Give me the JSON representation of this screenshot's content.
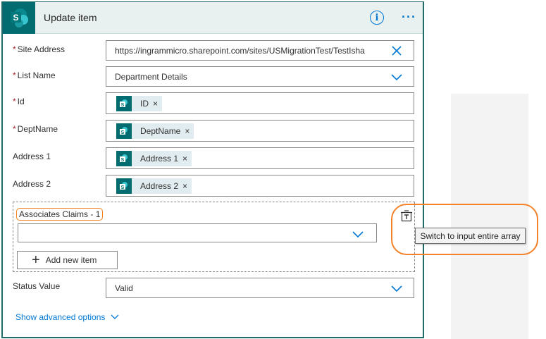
{
  "header": {
    "title": "Update item",
    "logo_letter": "S",
    "info_icon": "info-icon",
    "more_icon": "more-icon"
  },
  "fields": {
    "site_address": {
      "label": "Site Address",
      "required": "*",
      "value": "https://ingrammicro.sharepoint.com/sites/USMigrationTest/TestIsha"
    },
    "list_name": {
      "label": "List Name",
      "required": "*",
      "value": "Department Details"
    },
    "id": {
      "label": "Id",
      "required": "*",
      "token": "ID"
    },
    "dept_name": {
      "label": "DeptName",
      "required": "*",
      "token": "DeptName"
    },
    "address1": {
      "label": "Address 1",
      "token": "Address 1"
    },
    "address2": {
      "label": "Address 2",
      "token": "Address 2"
    },
    "status_value": {
      "label": "Status Value",
      "value": "Valid"
    }
  },
  "token_remove": "×",
  "array": {
    "label": "Associates Claims - 1",
    "add_label": "Add new item",
    "tooltip": "Switch to input entire array"
  },
  "advanced_label": "Show advanced options",
  "colors": {
    "brand": "#036c70",
    "accent": "#0078d4",
    "highlight": "#f58220",
    "required": "#a4262c"
  }
}
